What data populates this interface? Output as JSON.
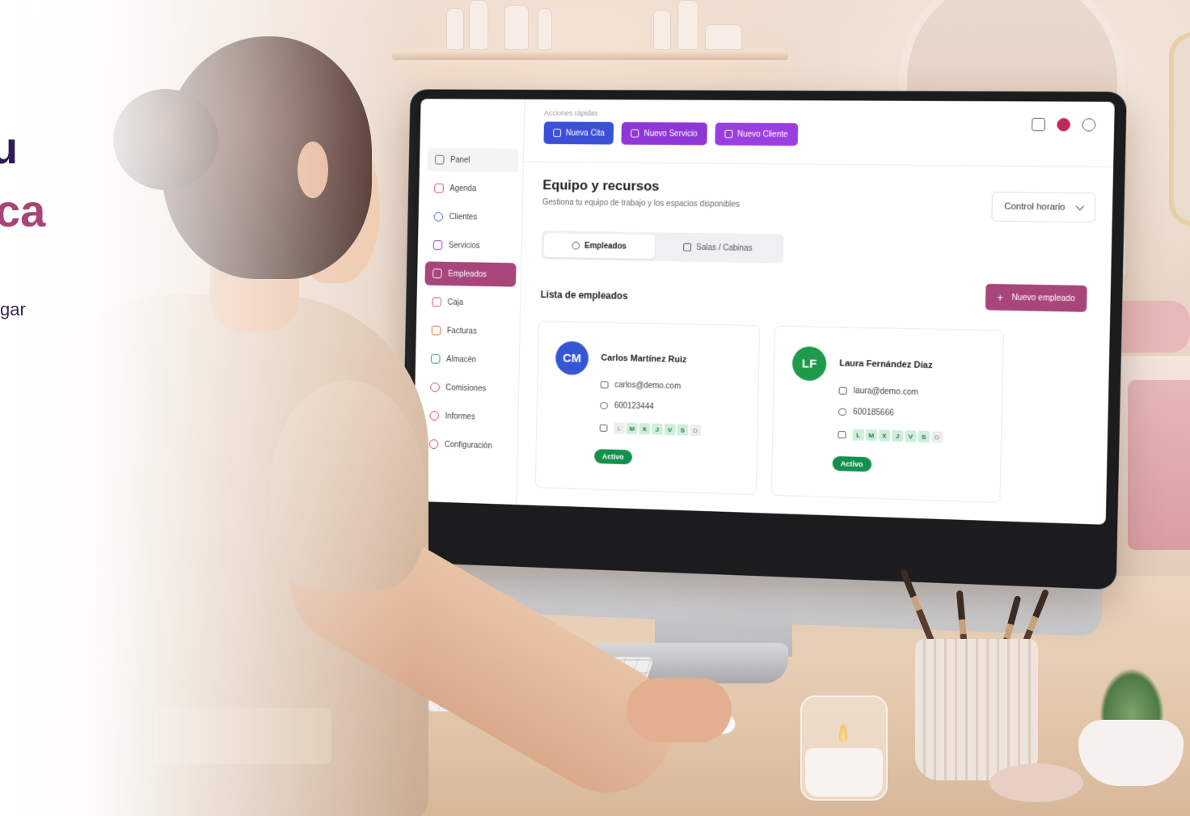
{
  "hero": {
    "line1": "u",
    "line2": "ca",
    "line3": "gar"
  },
  "sidebar": {
    "items": [
      {
        "label": "Panel",
        "icon": "dashboard-icon"
      },
      {
        "label": "Agenda",
        "icon": "calendar-icon"
      },
      {
        "label": "Clientes",
        "icon": "user-icon"
      },
      {
        "label": "Servicios",
        "icon": "sparkle-icon"
      },
      {
        "label": "Empleados",
        "icon": "badge-icon",
        "active": true
      },
      {
        "label": "Caja",
        "icon": "cash-register-icon"
      },
      {
        "label": "Facturas",
        "icon": "invoice-icon"
      },
      {
        "label": "Almacén",
        "icon": "warehouse-icon"
      },
      {
        "label": "Comisiones",
        "icon": "commission-icon"
      },
      {
        "label": "Informes",
        "icon": "report-icon"
      },
      {
        "label": "Configuración",
        "icon": "gear-icon"
      }
    ]
  },
  "quick_actions": {
    "label": "Acciones rápidas",
    "buttons": [
      {
        "label": "Nueva Cita",
        "color": "#3b4fd9"
      },
      {
        "label": "Nuevo Servicio",
        "color": "#8f36d6"
      },
      {
        "label": "Nuevo Cliente",
        "color": "#9a3ee0"
      }
    ]
  },
  "page": {
    "title": "Equipo y recursos",
    "subtitle": "Gestiona tu equipo de trabajo y los espacios disponibles",
    "control_select": "Control horario"
  },
  "tabs": [
    {
      "label": "Empleados",
      "active": true
    },
    {
      "label": "Salas / Cabinas",
      "active": false
    }
  ],
  "list": {
    "title": "Lista de empleados",
    "new_button": "Nuevo empleado"
  },
  "employees": [
    {
      "initials": "CM",
      "name": "Carlos Martínez Ruiz",
      "email": "carlos@demo.com",
      "phone": "600123444",
      "days": [
        {
          "d": "L",
          "on": false
        },
        {
          "d": "M",
          "on": true
        },
        {
          "d": "X",
          "on": true
        },
        {
          "d": "J",
          "on": true
        },
        {
          "d": "V",
          "on": true
        },
        {
          "d": "S",
          "on": true
        },
        {
          "d": "D",
          "on": false
        }
      ],
      "status": "Activo",
      "color": "#3557d6"
    },
    {
      "initials": "LF",
      "name": "Laura Fernández Díaz",
      "email": "laura@demo.com",
      "phone": "600185666",
      "days": [
        {
          "d": "L",
          "on": true
        },
        {
          "d": "M",
          "on": true
        },
        {
          "d": "X",
          "on": true
        },
        {
          "d": "J",
          "on": true
        },
        {
          "d": "V",
          "on": true
        },
        {
          "d": "S",
          "on": true
        },
        {
          "d": "D",
          "on": false
        }
      ],
      "status": "Activo",
      "color": "#1e9b4a"
    }
  ],
  "colors": {
    "accent": "#a8457a",
    "active_status": "#13904b"
  }
}
